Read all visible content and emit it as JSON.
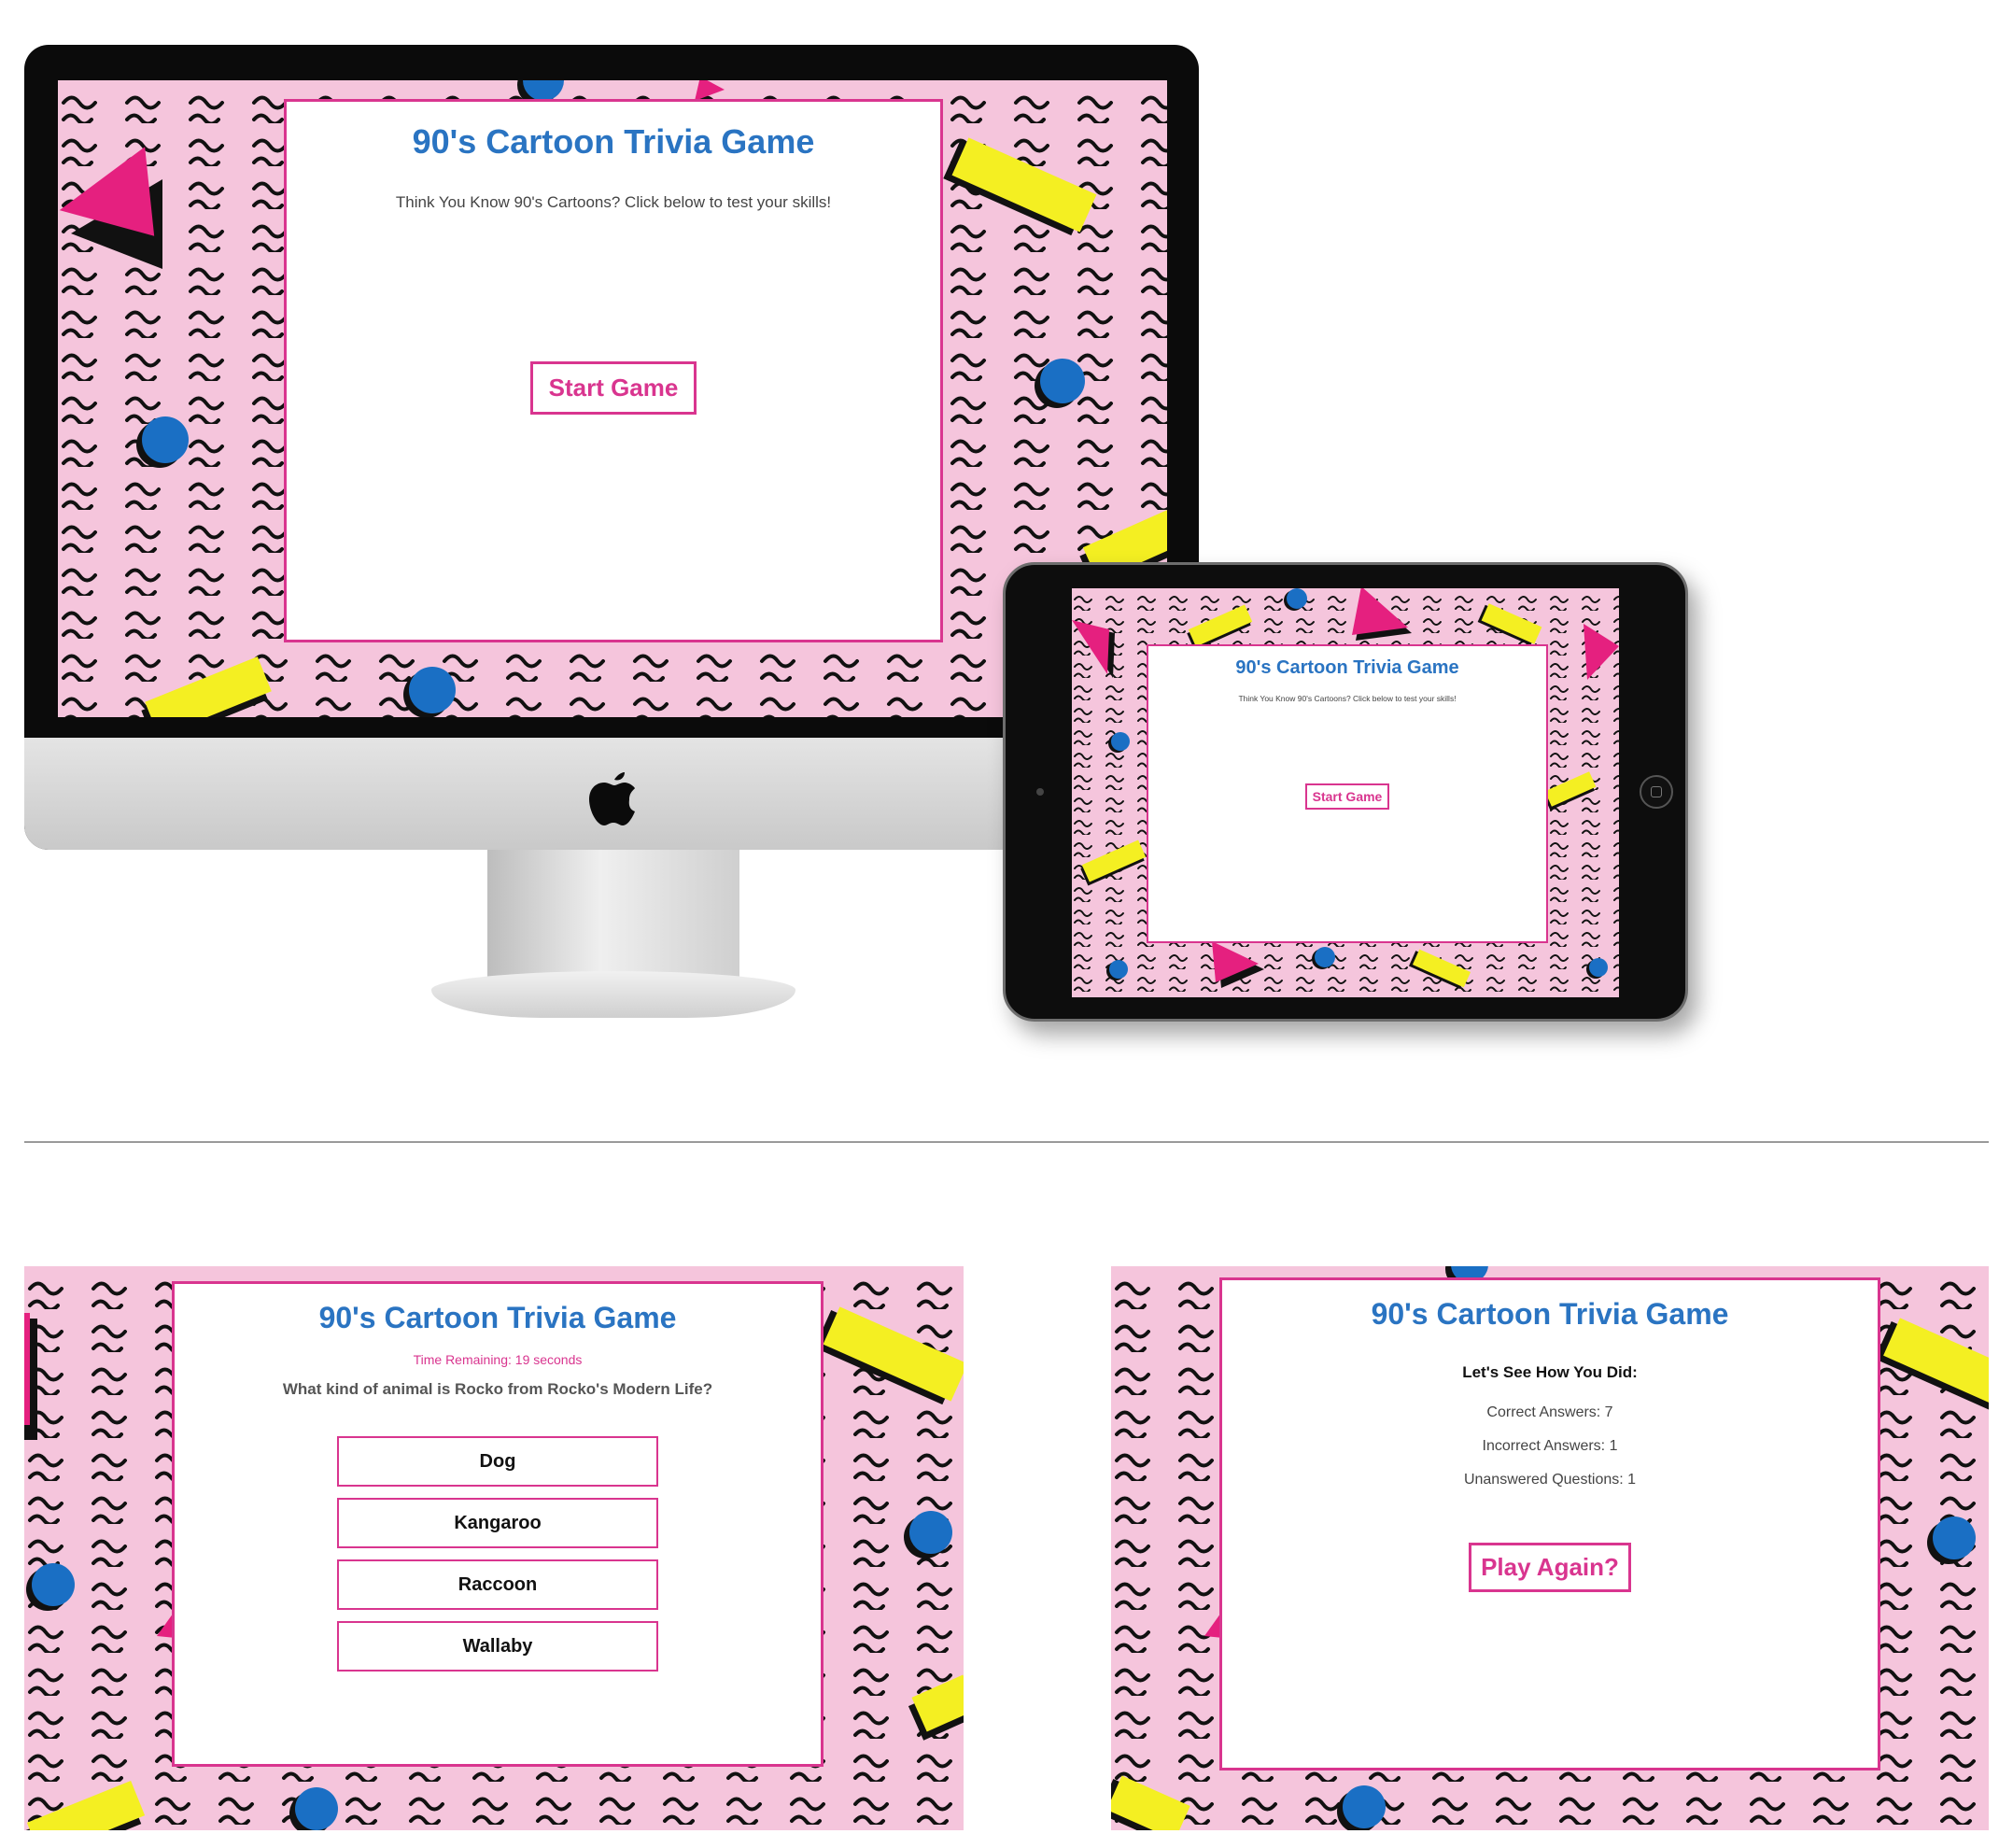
{
  "theme": {
    "background_pink": "#f5c5dc",
    "accent_pink": "#d9358f",
    "title_blue": "#2a74c2",
    "shape_blue": "#1a6fc4",
    "shape_yellow": "#f4ef22",
    "shape_magenta": "#e5207f"
  },
  "desktop": {
    "title": "90's Cartoon Trivia Game",
    "subtitle": "Think You Know 90's Cartoons? Click below to test your skills!",
    "start_button": "Start Game",
    "logo_icon": "apple-icon"
  },
  "tablet": {
    "title": "90's Cartoon Trivia Game",
    "subtitle": "Think You Know 90's Cartoons? Click below to test your skills!",
    "start_button": "Start Game"
  },
  "question_screen": {
    "title": "90's Cartoon Trivia Game",
    "timer": "Time Remaining: 19 seconds",
    "question": "What kind of animal is Rocko from Rocko's Modern Life?",
    "answers": [
      "Dog",
      "Kangaroo",
      "Raccoon",
      "Wallaby"
    ]
  },
  "results_screen": {
    "title": "90's Cartoon Trivia Game",
    "heading": "Let's See How You Did:",
    "correct": "Correct Answers: 7",
    "incorrect": "Incorrect Answers: 1",
    "unanswered": "Unanswered Questions: 1",
    "play_again": "Play Again?"
  }
}
